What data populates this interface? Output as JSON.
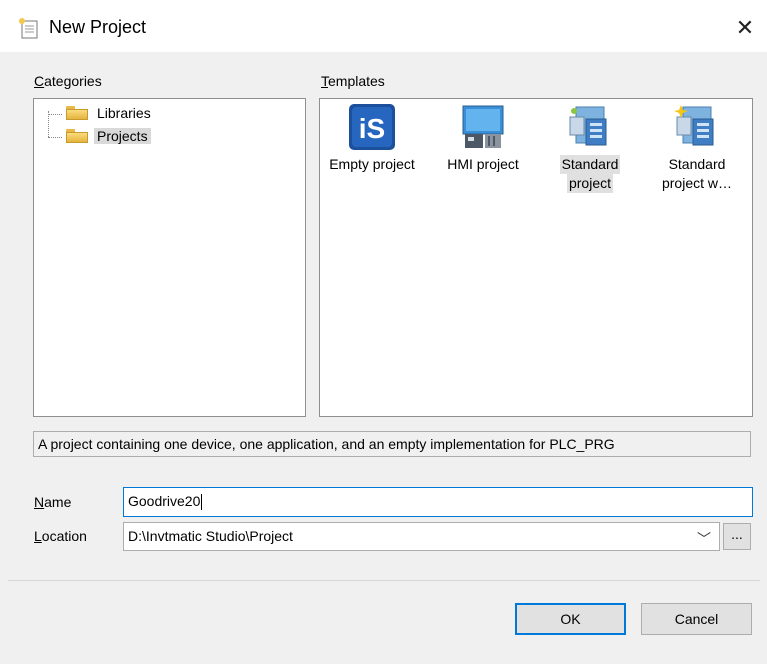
{
  "window": {
    "title": "New Project",
    "close_icon": "close-icon"
  },
  "categories": {
    "label": "Categories",
    "accesskey": "C",
    "rest": "ategories",
    "items": [
      {
        "label": "Libraries",
        "selected": false
      },
      {
        "label": "Projects",
        "selected": true
      }
    ]
  },
  "templates": {
    "label": "Templates",
    "accesskey": "T",
    "rest": "emplates",
    "items": [
      {
        "line1": "Empty project",
        "line2": "",
        "icon": "is-logo-icon",
        "selected": false
      },
      {
        "line1": "HMI project",
        "line2": "",
        "icon": "hmi-screen-icon",
        "selected": false
      },
      {
        "line1": "Standard",
        "line2": "project",
        "icon": "standard-project-icon",
        "selected": true
      },
      {
        "line1": "Standard",
        "line2": "project w…",
        "icon": "standard-project-wizard-icon",
        "selected": false
      }
    ]
  },
  "description": "A project containing one device, one application, and an empty implementation for PLC_PRG",
  "name_field": {
    "label": "Name",
    "accesskey": "N",
    "rest": "ame",
    "value": "Goodrive20"
  },
  "location_field": {
    "label": "Location",
    "accesskey": "L",
    "rest": "ocation",
    "value": "D:\\Invtmatic Studio\\Project",
    "browse_label": "..."
  },
  "buttons": {
    "ok": "OK",
    "cancel": "Cancel"
  },
  "colors": {
    "accent": "#0078d7",
    "panel_border": "#8f8f8f",
    "window_bg": "#f0f0f0"
  }
}
